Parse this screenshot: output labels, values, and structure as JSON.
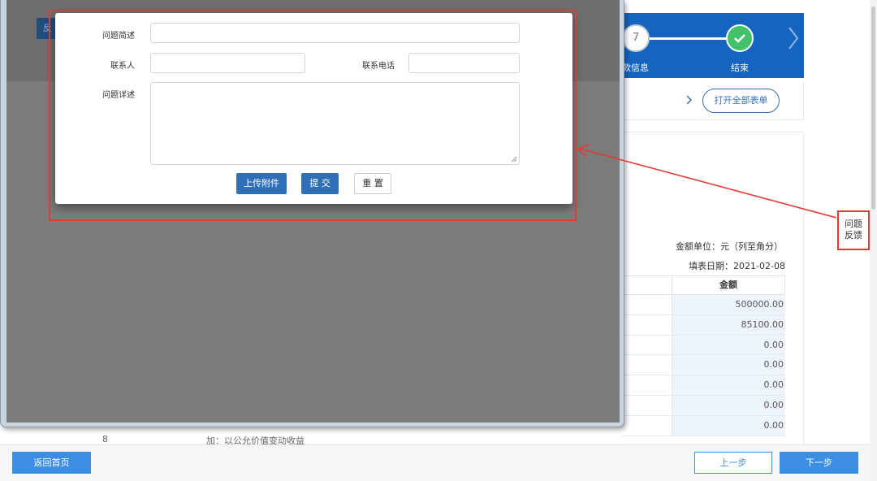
{
  "background": {
    "steps": {
      "step7_number": "7",
      "step7_label": "款信息",
      "end_label": "结束"
    },
    "open_all_label": "打开全部表单",
    "unit_text": "金额单位：元（列至角分）",
    "fill_date_text": "填表日期：2021-02-08",
    "amount_header": "金额",
    "amounts": [
      "500000.00",
      "85100.00",
      "0.00",
      "0.00",
      "0.00",
      "0.00",
      "0.00"
    ],
    "ghost_rows": [
      {
        "num": "8",
        "text": "加：以公允价值变动收益"
      }
    ]
  },
  "feedback": {
    "line1": "问题",
    "line2": "反馈"
  },
  "footer": {
    "home_label": "返回首页",
    "prev_label": "上一步",
    "next_label": "下一步"
  },
  "popup": {
    "tab_text": "反馈",
    "dialog": {
      "summary_label": "问题简述",
      "summary_value": "",
      "contact_label": "联系人",
      "contact_value": "",
      "phone_label": "联系电话",
      "phone_value": "",
      "detail_label": "问题详述",
      "detail_value": "",
      "upload_label": "上传附件",
      "submit_label": "提 交",
      "reset_label": "重 置"
    }
  },
  "colors": {
    "brand_blue": "#1565c0",
    "button_blue": "#2f6fb7",
    "footer_button_blue": "#3c8ee3",
    "success_green": "#43c06a",
    "annotation_red": "#e53935",
    "overlay_gray": "#7b7b7b"
  },
  "icons": {
    "step_done": "check-icon",
    "step_next": "chevron-right-icon",
    "panel_chevron": "chevron-right-icon",
    "textarea_resize": "resize-grip-icon",
    "annotation_arrow": "arrow-icon"
  }
}
